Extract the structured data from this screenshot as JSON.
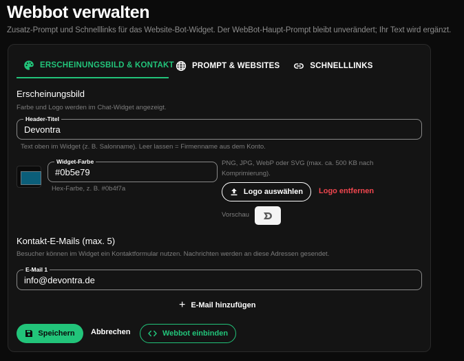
{
  "page": {
    "title": "Webbot verwalten",
    "subtitle": "Zusatz-Prompt und Schnelllinks für das Website-Bot-Widget. Der WebBot-Haupt-Prompt bleibt unverändert; Ihr Text wird ergänzt."
  },
  "tabs": [
    {
      "label": "ERSCHEINUNGSBILD & KONTAKT",
      "icon": "palette-icon",
      "active": true
    },
    {
      "label": "PROMPT & WEBSITES",
      "icon": "globe-icon",
      "active": false
    },
    {
      "label": "SCHNELLLINKS",
      "icon": "link-icon",
      "active": false
    }
  ],
  "appearance": {
    "title": "Erscheinungsbild",
    "help": "Farbe und Logo werden im Chat-Widget angezeigt.",
    "header_title_label": "Header-Titel",
    "header_title_value": "Devontra",
    "header_title_help": "Text oben im Widget (z. B. Salonname). Leer lassen = Firmenname aus dem Konto.",
    "widget_color_label": "Widget-Farbe",
    "widget_color_value": "#0b5e79",
    "widget_color_help": "Hex-Farbe, z. B. #0b4f7a",
    "logo_help_line1": "PNG, JPG, WebP oder SVG (max. ca. 500 KB nach",
    "logo_help_line2": "Komprimierung).",
    "logo_select_label": "Logo auswählen",
    "logo_remove_label": "Logo entfernen",
    "preview_label": "Vorschau"
  },
  "contact": {
    "title": "Kontakt-E-Mails (max. 5)",
    "help": "Besucher können im Widget ein Kontaktformular nutzen. Nachrichten werden an diese Adressen gesendet.",
    "emails": [
      {
        "label": "E-Mail 1",
        "value": "info@devontra.de"
      }
    ],
    "add_label": "E-Mail hinzufügen"
  },
  "actions": {
    "save_label": "Speichern",
    "cancel_label": "Abbrechen",
    "embed_label": "Webbot einbinden"
  },
  "colors": {
    "accent": "#22c47a",
    "danger": "#f0464e",
    "background": "#0b0b0b",
    "card": "#141414"
  }
}
